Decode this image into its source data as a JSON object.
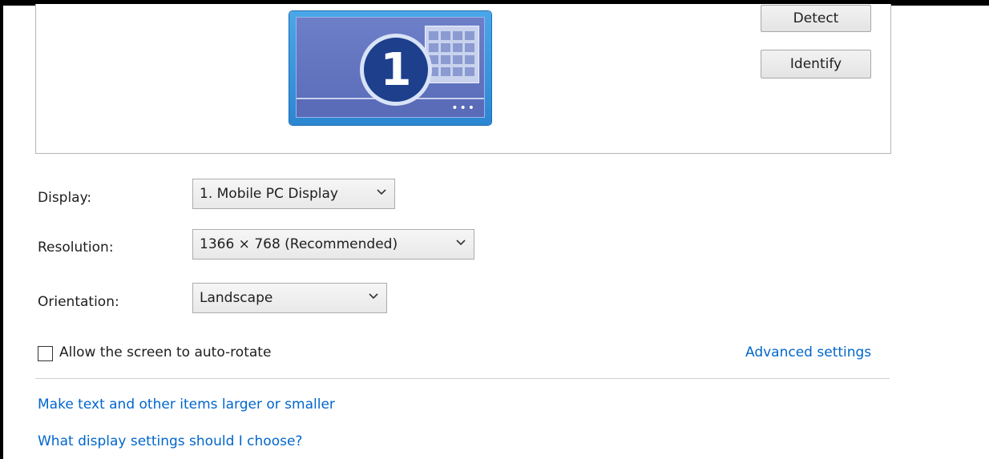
{
  "preview": {
    "monitor_number": "1"
  },
  "buttons": {
    "detect": "Detect",
    "identify": "Identify"
  },
  "settings": {
    "display_label": "Display:",
    "display_value": "1. Mobile PC Display",
    "resolution_label": "Resolution:",
    "resolution_value": "1366 × 768 (Recommended)",
    "orientation_label": "Orientation:",
    "orientation_value": "Landscape"
  },
  "auto_rotate": {
    "label": "Allow the screen to auto-rotate",
    "checked": false
  },
  "links": {
    "advanced_settings": "Advanced settings",
    "text_size": "Make text and other items larger or smaller",
    "display_help": "What display settings should I choose?"
  },
  "colors": {
    "link": "#0066cc",
    "monitor_frame": "#2b86d2",
    "monitor_badge": "#1d3f8c"
  }
}
